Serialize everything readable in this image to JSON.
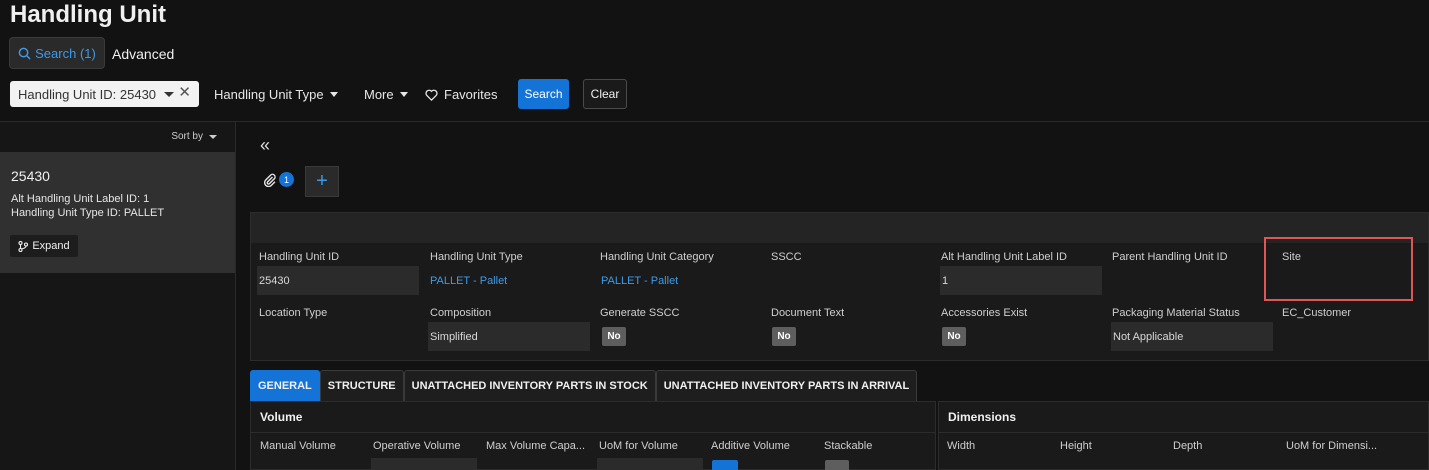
{
  "page": {
    "title": "Handling Unit"
  },
  "search": {
    "tab_label": "Search (1)",
    "advanced_label": "Advanced",
    "filter_chip": "Handling Unit ID: 25430",
    "filter_type": "Handling Unit Type",
    "more": "More",
    "favorites": "Favorites",
    "search_button": "Search",
    "clear_button": "Clear"
  },
  "list": {
    "sort_by": "Sort by",
    "record": {
      "id": "25430",
      "alt_label": "Alt Handling Unit Label ID:   1",
      "type": "Handling Unit Type ID:   PALLET",
      "expand": "Expand"
    }
  },
  "toolbar": {
    "attachment_count": "1",
    "add_symbol": "+"
  },
  "form": {
    "row1": [
      {
        "label": "Handling Unit ID",
        "value": "25430"
      },
      {
        "label": "Handling Unit Type",
        "link": "PALLET - Pallet"
      },
      {
        "label": "Handling Unit Category",
        "link": "PALLET - Pallet"
      },
      {
        "label": "SSCC"
      },
      {
        "label": "Alt Handling Unit Label ID",
        "value": "1"
      },
      {
        "label": "Parent Handling Unit ID"
      },
      {
        "label": "Site"
      }
    ],
    "row2": [
      {
        "label": "Location Type"
      },
      {
        "label": "Composition",
        "value": "Simplified"
      },
      {
        "label": "Generate SSCC",
        "badge": "No"
      },
      {
        "label": "Document Text",
        "badge": "No"
      },
      {
        "label": "Accessories Exist",
        "badge": "No"
      },
      {
        "label": "Packaging Material Status",
        "value": "Not Applicable"
      },
      {
        "label": "EC_Customer"
      }
    ]
  },
  "tabs": [
    {
      "label": "GENERAL",
      "active": true
    },
    {
      "label": "STRUCTURE"
    },
    {
      "label": "UNATTACHED INVENTORY PARTS IN STOCK"
    },
    {
      "label": "UNATTACHED INVENTORY PARTS IN ARRIVAL"
    }
  ],
  "volume": {
    "title": "Volume",
    "fields": [
      "Manual Volume",
      "Operative Volume",
      "Max Volume Capa...",
      "UoM for Volume",
      "Additive Volume",
      "Stackable"
    ]
  },
  "dimensions": {
    "title": "Dimensions",
    "fields": [
      "Width",
      "Height",
      "Depth",
      "UoM for Dimensi..."
    ]
  },
  "colors": {
    "accent": "#1473d6",
    "link": "#3d9ae8",
    "highlight": "#e05555"
  }
}
